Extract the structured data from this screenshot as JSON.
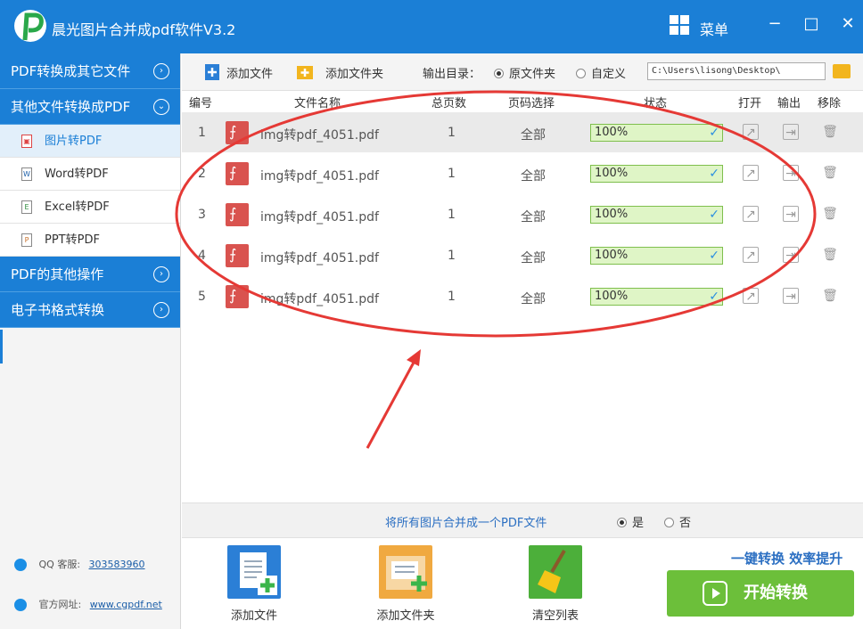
{
  "window": {
    "title": "晨光图片合并成pdf软件V3.2",
    "menu_label": "菜单",
    "minimize": "−",
    "maximize": "□",
    "close": "✕"
  },
  "sidebar": {
    "categories": [
      {
        "label": "PDF转换成其它文件",
        "chevron": "›"
      },
      {
        "label": "其他文件转换成PDF",
        "chevron": "⌄"
      },
      {
        "label": "PDF的其他操作",
        "chevron": "›"
      },
      {
        "label": "电子书格式转换",
        "chevron": "›"
      }
    ],
    "sub_items": [
      {
        "label": "图片转PDF",
        "icon": "image-file-icon"
      },
      {
        "label": "Word转PDF",
        "icon": "word-file-icon"
      },
      {
        "label": "Excel转PDF",
        "icon": "excel-file-icon"
      },
      {
        "label": "PPT转PDF",
        "icon": "ppt-file-icon"
      }
    ],
    "contact": {
      "qq_label": "QQ 客服:",
      "qq_value": "303583960",
      "site_label": "官方网址:",
      "site_value": "www.cgpdf.net"
    }
  },
  "toolbar": {
    "add_file": "添加文件",
    "add_folder": "添加文件夹",
    "output_label": "输出目录：",
    "opt_original": "原文件夹",
    "opt_custom": "自定义",
    "path": "C:\\Users\\lisong\\Desktop\\"
  },
  "table": {
    "headers": {
      "no": "编号",
      "name": "文件名称",
      "pages": "总页数",
      "range": "页码选择",
      "status": "状态",
      "open": "打开",
      "output": "输出",
      "remove": "移除"
    },
    "rows": [
      {
        "no": "1",
        "name": "img转pdf_4051.pdf",
        "pages": "1",
        "range": "全部",
        "status": "100%"
      },
      {
        "no": "2",
        "name": "img转pdf_4051.pdf",
        "pages": "1",
        "range": "全部",
        "status": "100%"
      },
      {
        "no": "3",
        "name": "img转pdf_4051.pdf",
        "pages": "1",
        "range": "全部",
        "status": "100%"
      },
      {
        "no": "4",
        "name": "img转pdf_4051.pdf",
        "pages": "1",
        "range": "全部",
        "status": "100%"
      },
      {
        "no": "5",
        "name": "img转pdf_4051.pdf",
        "pages": "1",
        "range": "全部",
        "status": "100%"
      }
    ]
  },
  "merge": {
    "label": "将所有图片合并成一个PDF文件",
    "yes": "是",
    "no": "否"
  },
  "bottom": {
    "add_file": "添加文件",
    "add_folder": "添加文件夹",
    "clear_list": "清空列表",
    "slogan": "一键转换  效率提升",
    "start": "开始转换"
  },
  "colors": {
    "brand_blue": "#1b7fd6",
    "start_green": "#6cbf3a",
    "annotation_red": "#e53935"
  }
}
